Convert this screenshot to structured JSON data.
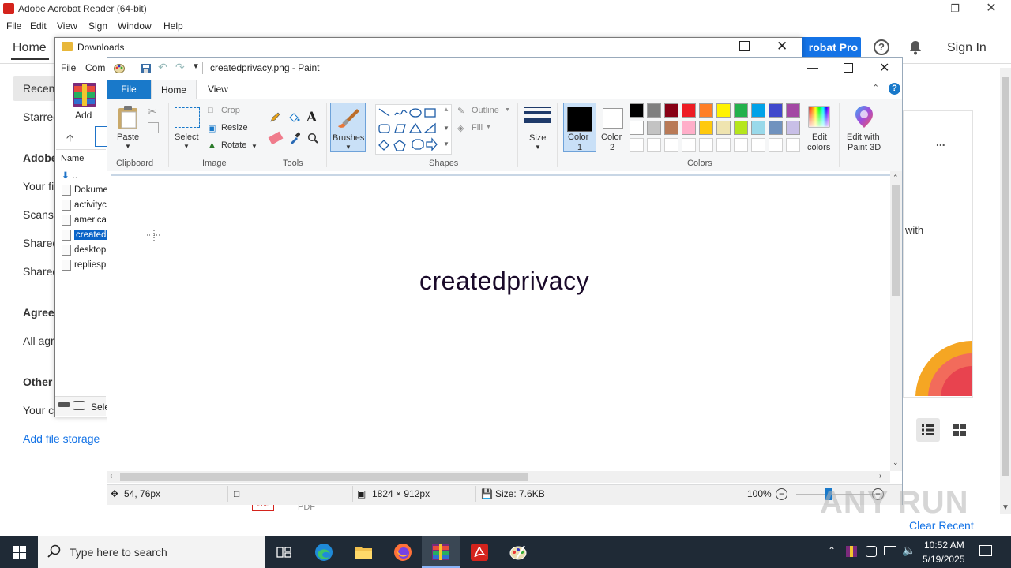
{
  "acrobat": {
    "title": "Adobe Acrobat Reader (64-bit)",
    "menu": [
      "File",
      "Edit",
      "View",
      "Sign",
      "Window",
      "Help"
    ],
    "home_tab": "Home",
    "pro_button": "robat Pro",
    "sign_in": "Sign In",
    "help_glyph": "?",
    "sidebar": {
      "recent": "Recent",
      "starred": "Starred",
      "adobe_section": "Adobe",
      "your_files": "Your fi",
      "scans": "Scans",
      "shared_1": "Shared",
      "shared_2": "Shared",
      "agree_section": "Agree",
      "all_agreements": "All agr",
      "other_section": "Other",
      "your_computer": "Your c",
      "add_file_storage": "Add file storage"
    },
    "card": {
      "dots": "...",
      "with_text": "with"
    },
    "clear_recent": "Clear Recent",
    "pdf_icon_label": "PDF",
    "pdf_label": "PDF"
  },
  "explorer": {
    "title": "Downloads",
    "ribbon_tabs": [
      "File",
      "Com"
    ],
    "add_label": "Add",
    "column_name": "Name",
    "rows": [
      "..",
      "Dokume",
      "activityc",
      "america",
      "created",
      "desktop",
      "repliesp"
    ],
    "status_text": "Sele"
  },
  "paint": {
    "title": "createdprivacy.png - Paint",
    "tabs": {
      "file": "File",
      "home": "Home",
      "view": "View"
    },
    "clipboard": {
      "paste": "Paste",
      "group": "Clipboard"
    },
    "image": {
      "select": "Select",
      "crop": "Crop",
      "resize": "Resize",
      "rotate": "Rotate",
      "group": "Image"
    },
    "tools_group": "Tools",
    "brushes": "Brushes",
    "shapes": {
      "outline": "Outline",
      "fill": "Fill",
      "group": "Shapes"
    },
    "size": "Size",
    "color1": {
      "line1": "Color",
      "line2": "1"
    },
    "color2": {
      "line1": "Color",
      "line2": "2"
    },
    "colors_group": "Colors",
    "edit_colors": {
      "line1": "Edit",
      "line2": "colors"
    },
    "edit_paint3d": {
      "line1": "Edit with",
      "line2": "Paint 3D"
    },
    "palette_row1": [
      "#000000",
      "#7f7f7f",
      "#880015",
      "#ed1c24",
      "#ff7f27",
      "#fff200",
      "#22b14c",
      "#00a2e8",
      "#3f48cc",
      "#a349a4"
    ],
    "palette_row2": [
      "#ffffff",
      "#c3c3c3",
      "#b97a57",
      "#ffaec9",
      "#ffc90e",
      "#efe4b0",
      "#b5e61d",
      "#99d9ea",
      "#7092be",
      "#c8bfe7"
    ],
    "canvas_text": "createdprivacy",
    "status": {
      "position": "54, 76px",
      "dimensions": "1824 × 912px",
      "file_size": "Size: 7.6KB",
      "zoom": "100%"
    }
  },
  "watermark": "ANY RUN",
  "taskbar": {
    "search_placeholder": "Type here to search",
    "time": "10:52 AM",
    "date": "5/19/2025"
  }
}
